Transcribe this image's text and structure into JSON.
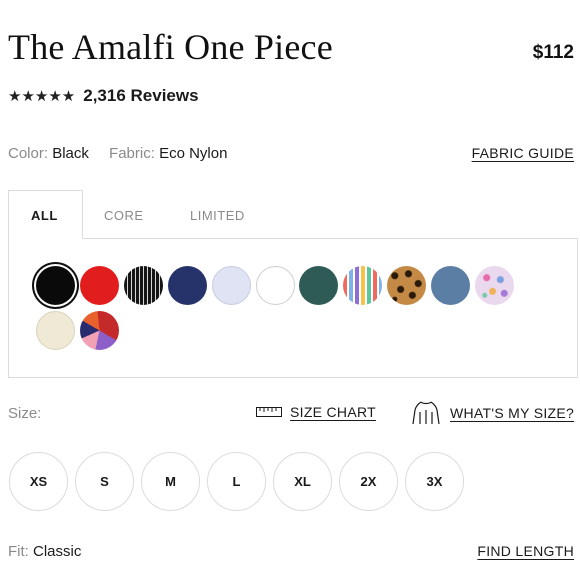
{
  "product": {
    "title": "The Amalfi One Piece",
    "price": "$112",
    "stars": "★★★★★",
    "review_count": "2,316 Reviews"
  },
  "attributes": {
    "color_label": "Color:",
    "color_value": "Black",
    "fabric_label": "Fabric:",
    "fabric_value": "Eco Nylon",
    "fabric_guide": "FABRIC GUIDE"
  },
  "tabs": [
    {
      "label": "ALL",
      "active": true
    },
    {
      "label": "CORE",
      "active": false
    },
    {
      "label": "LIMITED",
      "active": false
    }
  ],
  "swatches": [
    {
      "name": "black",
      "color": "#0a0a0a",
      "selected": true
    },
    {
      "name": "red",
      "color": "#e11d1d"
    },
    {
      "name": "black-pinstripe",
      "color": "#1a1a1a"
    },
    {
      "name": "navy",
      "color": "#26336b"
    },
    {
      "name": "light-lavender",
      "color": "#dfe3f3"
    },
    {
      "name": "white",
      "color": "#ffffff"
    },
    {
      "name": "dark-teal",
      "color": "#2f5b56"
    },
    {
      "name": "rainbow-stripe",
      "color": "#f3c1b8"
    },
    {
      "name": "leopard",
      "color": "#b07a3c"
    },
    {
      "name": "slate-blue",
      "color": "#5b7ea4"
    },
    {
      "name": "floral-pastel",
      "color": "#d8c2de"
    },
    {
      "name": "cream-textured",
      "color": "#efe9d5"
    },
    {
      "name": "abstract-print",
      "color": "#c52a2a"
    }
  ],
  "size": {
    "label": "Size:",
    "size_chart": "SIZE CHART",
    "whats_my_size": "WHAT'S MY SIZE?",
    "options": [
      "XS",
      "S",
      "M",
      "L",
      "XL",
      "2X",
      "3X"
    ]
  },
  "fit": {
    "label": "Fit:",
    "value": "Classic",
    "find_length": "FIND LENGTH"
  }
}
